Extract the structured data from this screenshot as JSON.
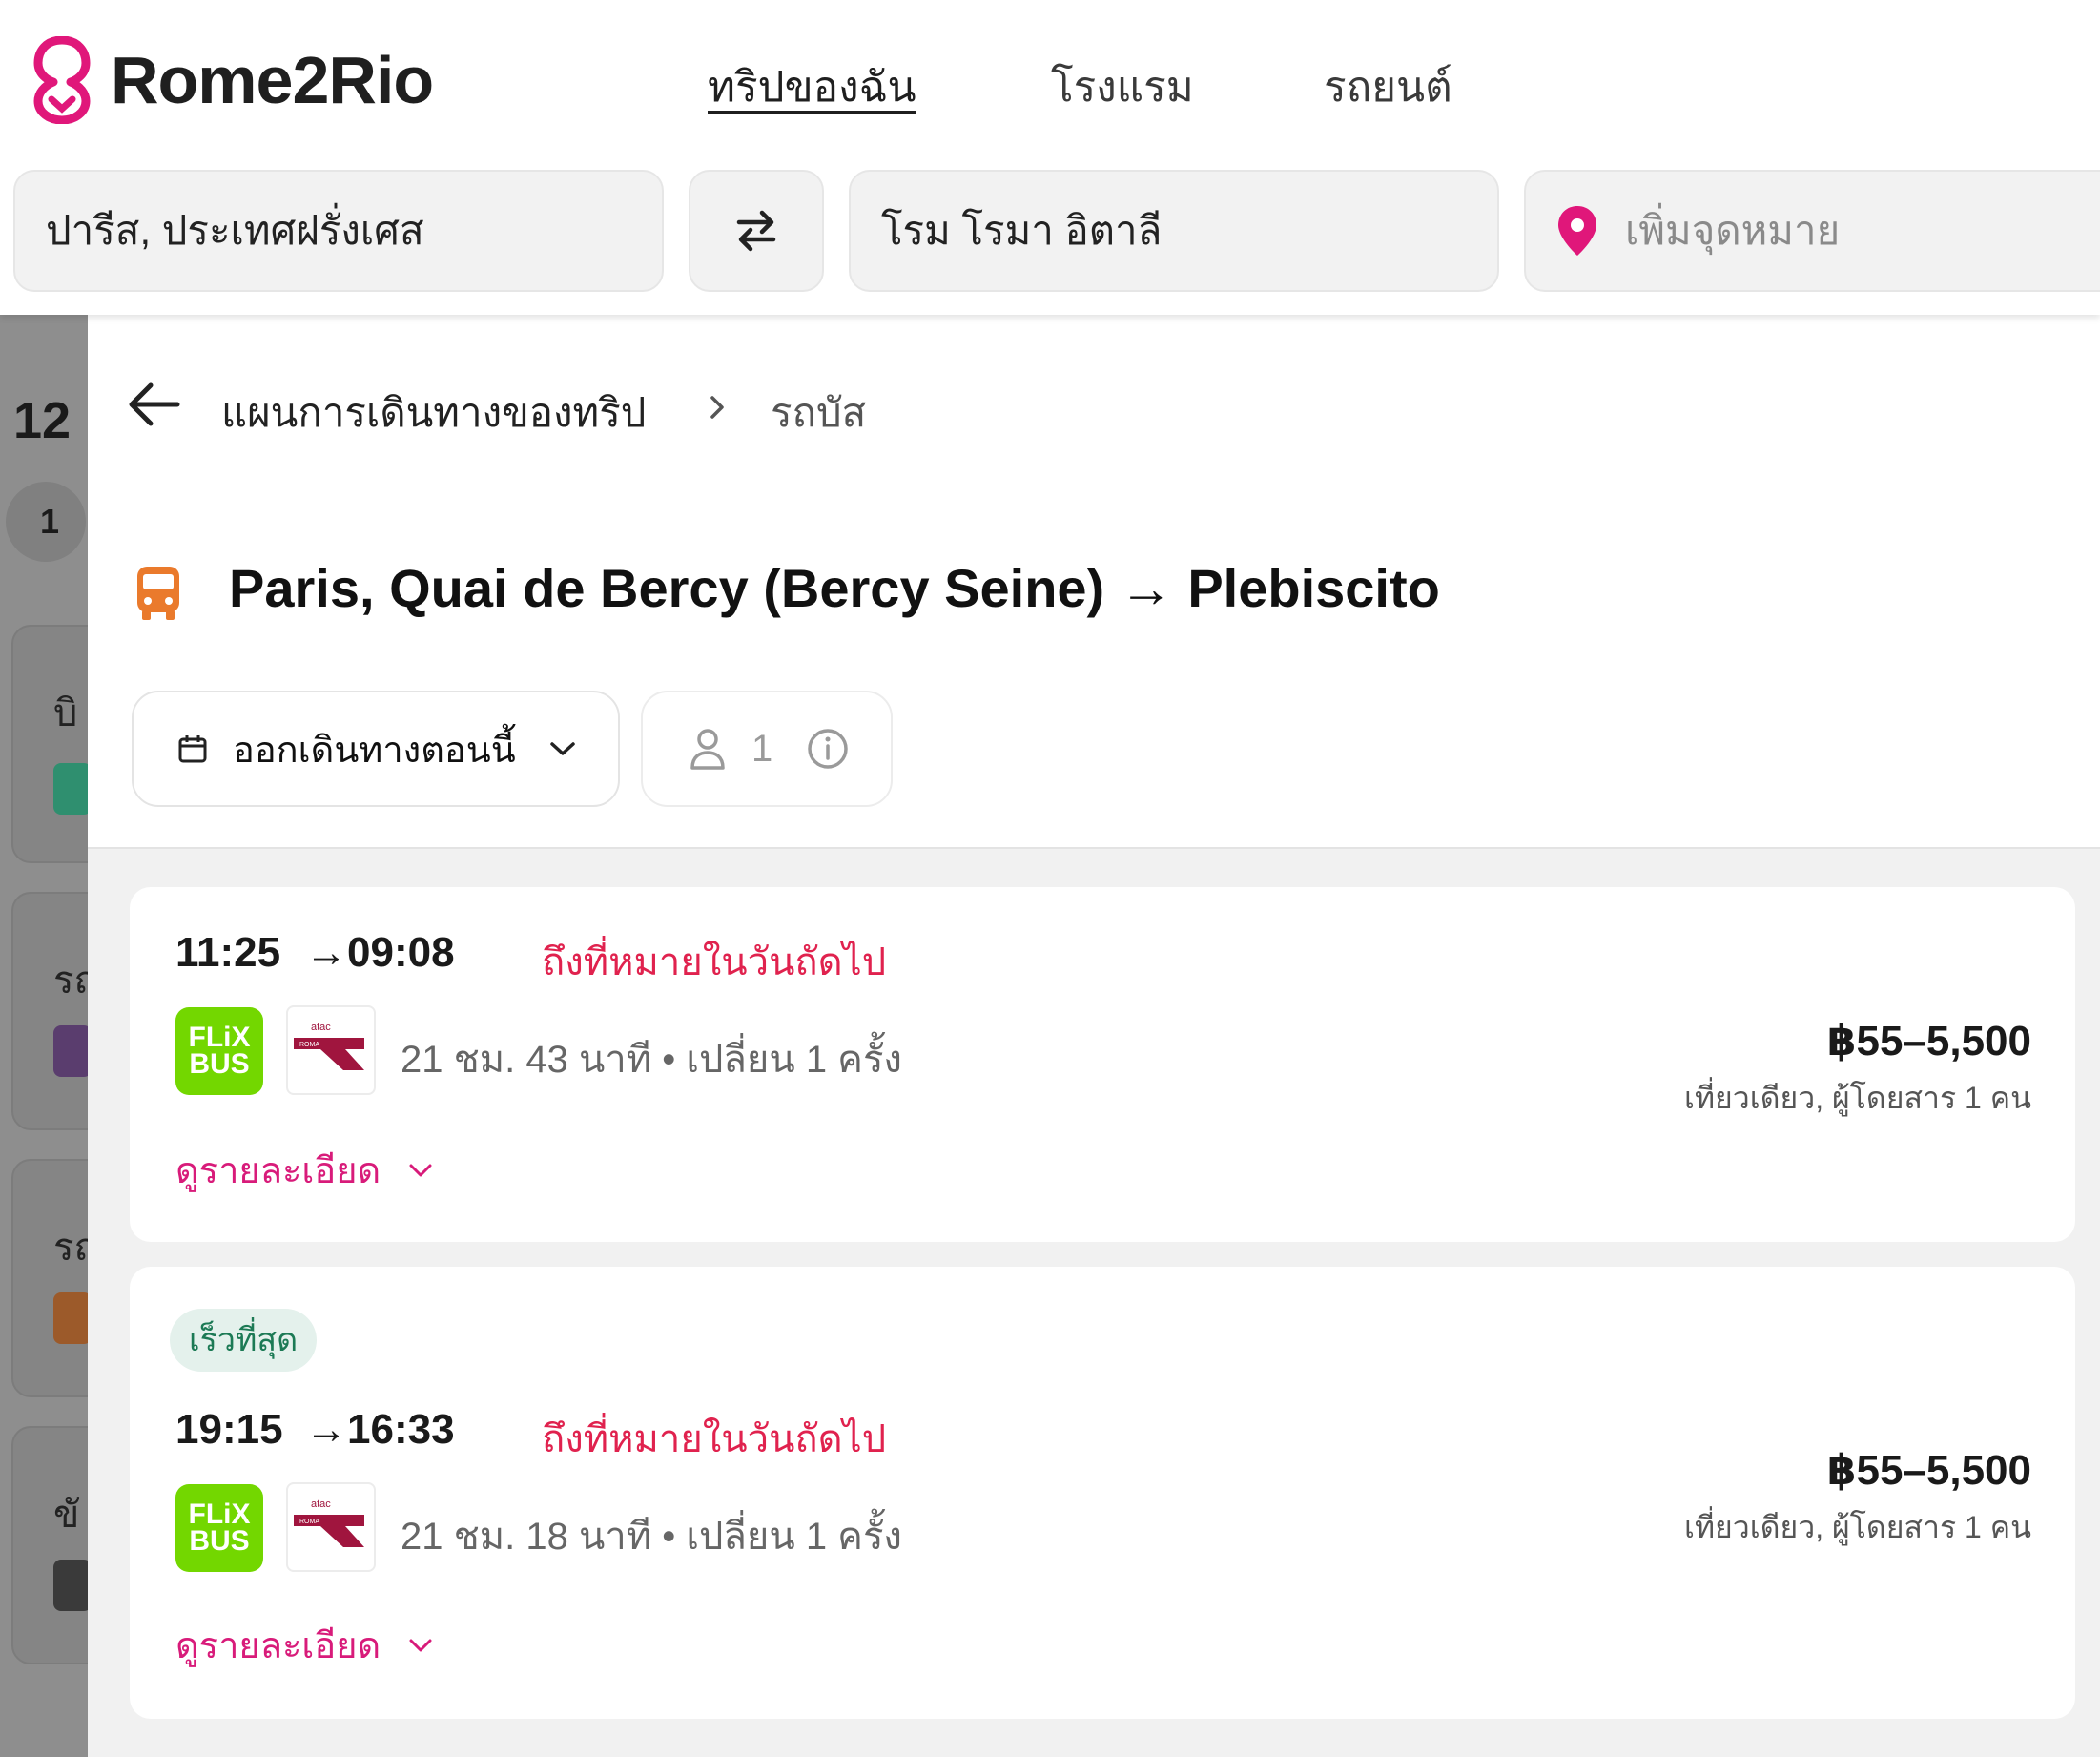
{
  "header": {
    "logo_text": "Rome2Rio",
    "nav": {
      "trips": "ทริปของฉัน",
      "hotels": "โรงแรม",
      "cars": "รถยนต์"
    },
    "search": {
      "from": "ปารีส, ประเทศฝรั่งเศส",
      "to": "โรม โรมา อิตาลี",
      "add_destination_placeholder": "เพิ่มจุดหมาย"
    },
    "brand_color": "#e0177a"
  },
  "background": {
    "partial_number": "12",
    "step_number": "1",
    "partial_labels": [
      "บิ",
      "รถ",
      "รถ",
      "ขั"
    ]
  },
  "panel": {
    "breadcrumb": {
      "parent": "แผนการเดินทางของทริป",
      "current": "รถบัส"
    },
    "route_title": "Paris, Quai de Bercy (Bercy Seine) → Plebiscito",
    "date_button_label": "ออกเดินทางตอนนี้",
    "passengers": "1"
  },
  "results": [
    {
      "badge": "",
      "depart": "11:25",
      "arrow": "→",
      "arrive": "09:08",
      "next_day": "ถึงที่หมายในวันถัดไป",
      "operators": [
        "FLiX BUS",
        "atac ROMA"
      ],
      "duration": "21 ชม. 43 นาที • เปลี่ยน 1 ครั้ง",
      "price": "฿55–5,500",
      "price_note": "เที่ยวเดียว, ผู้โดยสาร 1 คน",
      "details_link": "ดูรายละเอียด"
    },
    {
      "badge": "เร็วที่สุด",
      "depart": "19:15",
      "arrow": "→",
      "arrive": "16:33",
      "next_day": "ถึงที่หมายในวันถัดไป",
      "operators": [
        "FLiX BUS",
        "atac ROMA"
      ],
      "duration": "21 ชม. 18 นาที • เปลี่ยน 1 ครั้ง",
      "price": "฿55–5,500",
      "price_note": "เที่ยวเดียว, ผู้โดยสาร 1 คน",
      "details_link": "ดูรายละเอียด"
    }
  ],
  "operator_logos": {
    "flixbus_line1": "FLiX",
    "flixbus_line2": "BUS",
    "flixbus_color": "#73d700",
    "atac_top": "atac",
    "atac_bottom": "ROMA"
  }
}
